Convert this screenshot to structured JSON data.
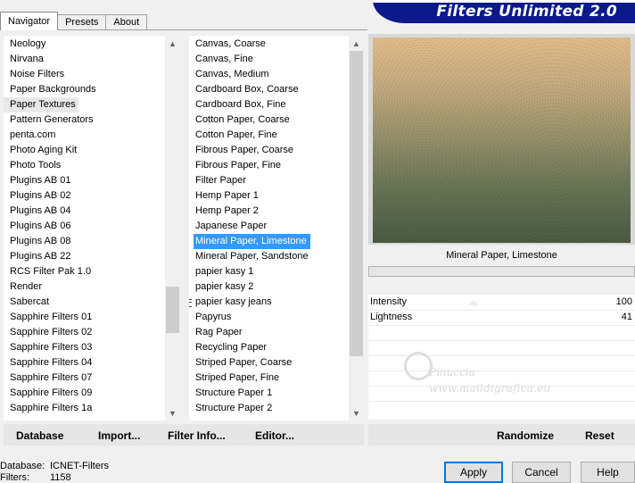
{
  "tabs": [
    "Navigator",
    "Presets",
    "About"
  ],
  "app_title": "Filters Unlimited 2.0",
  "categories": [
    "Neology",
    "Nirvana",
    "Noise Filters",
    "Paper Backgrounds",
    "Paper Textures",
    "Pattern Generators",
    "penta.com",
    "Photo Aging Kit",
    "Photo Tools",
    "Plugins AB 01",
    "Plugins AB 02",
    "Plugins AB 04",
    "Plugins AB 06",
    "Plugins AB 08",
    "Plugins AB 22",
    "RCS Filter Pak 1.0",
    "Render",
    "Sabercat",
    "Sapphire Filters 01",
    "Sapphire Filters 02",
    "Sapphire Filters 03",
    "Sapphire Filters 04",
    "Sapphire Filters 07",
    "Sapphire Filters 09",
    "Sapphire Filters 1a"
  ],
  "selected_category": "Paper Textures",
  "filters": [
    "Canvas, Coarse",
    "Canvas, Fine",
    "Canvas, Medium",
    "Cardboard Box, Coarse",
    "Cardboard Box, Fine",
    "Cotton Paper, Coarse",
    "Cotton Paper, Fine",
    "Fibrous Paper, Coarse",
    "Fibrous Paper, Fine",
    "Filter Paper",
    "Hemp Paper 1",
    "Hemp Paper 2",
    "Japanese Paper",
    "Mineral Paper, Limestone",
    "Mineral Paper, Sandstone",
    "papier kasy 1",
    "papier kasy 2",
    "papier kasy jeans",
    "Papyrus",
    "Rag Paper",
    "Recycling Paper",
    "Striped Paper, Coarse",
    "Striped Paper, Fine",
    "Structure Paper 1",
    "Structure Paper 2"
  ],
  "selected_filter": "Mineral Paper, Limestone",
  "preview_label": "Mineral Paper, Limestone",
  "params": [
    {
      "label": "Intensity",
      "value": "100"
    },
    {
      "label": "Lightness",
      "value": "41"
    }
  ],
  "watermark": {
    "name": "Pinuccia",
    "url": "www.maildigrafica.eu"
  },
  "left_buttons": {
    "database": "Database",
    "import": "Import...",
    "filter_info": "Filter Info...",
    "editor": "Editor..."
  },
  "right_buttons": {
    "randomize": "Randomize",
    "reset": "Reset"
  },
  "status": {
    "database_label": "Database:",
    "database_value": "ICNET-Filters",
    "filters_label": "Filters:",
    "filters_value": "1158"
  },
  "dialog_buttons": {
    "apply": "Apply",
    "cancel": "Cancel",
    "help": "Help"
  },
  "colors": {
    "banner": "#0a1a8a",
    "selection": "#3399ff"
  }
}
